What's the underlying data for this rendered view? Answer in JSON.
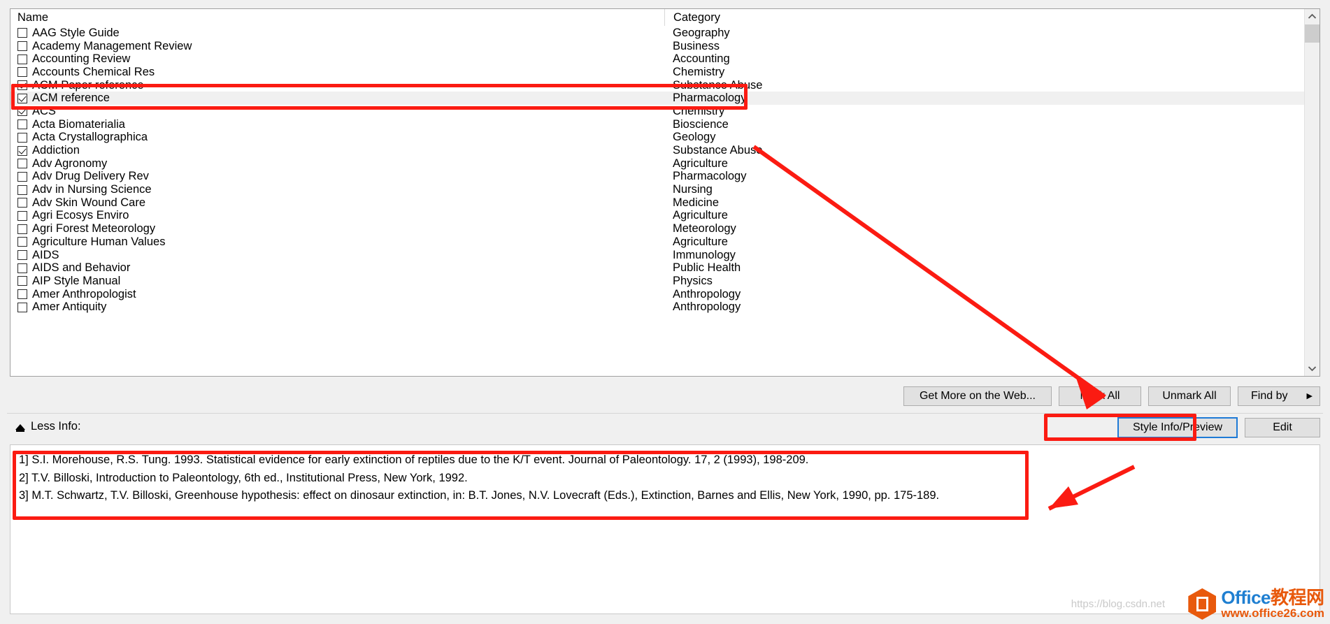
{
  "list": {
    "columns": {
      "name": "Name",
      "category": "Category"
    },
    "rows": [
      {
        "name": "AAG Style Guide",
        "category": "Geography",
        "checked": false,
        "selected": false
      },
      {
        "name": "Academy Management Review",
        "category": "Business",
        "checked": false,
        "selected": false
      },
      {
        "name": "Accounting Review",
        "category": "Accounting",
        "checked": false,
        "selected": false
      },
      {
        "name": "Accounts Chemical Res",
        "category": "Chemistry",
        "checked": false,
        "selected": false
      },
      {
        "name": "ACM Paper reference",
        "category": "Substance Abuse",
        "checked": true,
        "selected": false
      },
      {
        "name": "ACM reference",
        "category": "Pharmacology",
        "checked": true,
        "selected": true
      },
      {
        "name": "ACS",
        "category": "Chemistry",
        "checked": true,
        "selected": false
      },
      {
        "name": "Acta Biomaterialia",
        "category": "Bioscience",
        "checked": false,
        "selected": false
      },
      {
        "name": "Acta Crystallographica",
        "category": "Geology",
        "checked": false,
        "selected": false
      },
      {
        "name": "Addiction",
        "category": "Substance Abuse",
        "checked": true,
        "selected": false
      },
      {
        "name": "Adv Agronomy",
        "category": "Agriculture",
        "checked": false,
        "selected": false
      },
      {
        "name": "Adv Drug Delivery Rev",
        "category": "Pharmacology",
        "checked": false,
        "selected": false
      },
      {
        "name": "Adv in Nursing Science",
        "category": "Nursing",
        "checked": false,
        "selected": false
      },
      {
        "name": "Adv Skin Wound Care",
        "category": "Medicine",
        "checked": false,
        "selected": false
      },
      {
        "name": "Agri Ecosys Enviro",
        "category": "Agriculture",
        "checked": false,
        "selected": false
      },
      {
        "name": "Agri Forest Meteorology",
        "category": "Meteorology",
        "checked": false,
        "selected": false
      },
      {
        "name": "Agriculture Human Values",
        "category": "Agriculture",
        "checked": false,
        "selected": false
      },
      {
        "name": "AIDS",
        "category": "Immunology",
        "checked": false,
        "selected": false
      },
      {
        "name": "AIDS and Behavior",
        "category": "Public Health",
        "checked": false,
        "selected": false
      },
      {
        "name": "AIP Style Manual",
        "category": "Physics",
        "checked": false,
        "selected": false
      },
      {
        "name": "Amer Anthropologist",
        "category": "Anthropology",
        "checked": false,
        "selected": false
      },
      {
        "name": "Amer Antiquity",
        "category": "Anthropology",
        "checked": false,
        "selected": false
      }
    ]
  },
  "toolbar": {
    "get_more_label": "Get More on the Web...",
    "mark_all_label": "Mark All",
    "unmark_all_label": "Unmark All",
    "find_by_label": "Find by",
    "find_by_caret": "▶"
  },
  "info": {
    "less_info_label": "Less Info:",
    "style_info_label": "Style Info/Preview",
    "edit_label": "Edit"
  },
  "preview": {
    "lines": [
      "1] S.I. Morehouse, R.S. Tung. 1993. Statistical evidence for early extinction of reptiles due to the K/T event. Journal of Paleontology. 17, 2 (1993), 198-209.",
      "2] T.V. Billoski, Introduction to Paleontology, 6th ed., Institutional Press, New York, 1992.",
      "3] M.T. Schwartz, T.V. Billoski, Greenhouse hypothesis: effect on dinosaur extinction, in: B.T. Jones, N.V. Lovecraft (Eds.), Extinction, Barnes and Ellis, New York, 1990, pp. 175-189."
    ]
  },
  "watermark": {
    "brand_en": "Office",
    "brand_cn": "教程网",
    "url": "www.office26.com",
    "blog_text": "https://blog.csdn.net"
  },
  "colors": {
    "annotation_red": "#fb1b12",
    "focus_blue": "#1e7ad6",
    "selection_gray": "#f0f0f0",
    "brand_orange": "#e8590c",
    "brand_blue": "#1f7fd1"
  }
}
